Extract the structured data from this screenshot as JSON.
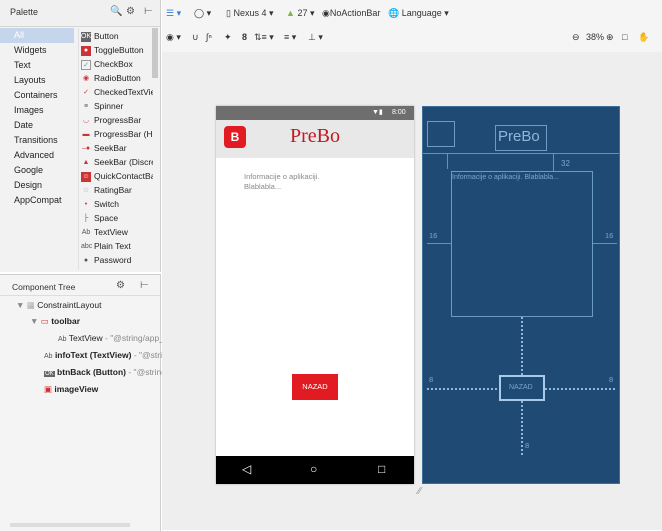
{
  "palette": {
    "title": "Palette",
    "categories": [
      "All",
      "Widgets",
      "Text",
      "Layouts",
      "Containers",
      "Images",
      "Date",
      "Transitions",
      "Advanced",
      "Google",
      "Design",
      "AppCompat"
    ],
    "widgets": [
      {
        "label": "Button",
        "icon": "button-icon"
      },
      {
        "label": "ToggleButton",
        "icon": "togglebutton-icon"
      },
      {
        "label": "CheckBox",
        "icon": "checkbox-icon"
      },
      {
        "label": "RadioButton",
        "icon": "radiobutton-icon"
      },
      {
        "label": "CheckedTextView",
        "icon": "checkedtextview-icon"
      },
      {
        "label": "Spinner",
        "icon": "spinner-icon"
      },
      {
        "label": "ProgressBar",
        "icon": "progressbar-icon"
      },
      {
        "label": "ProgressBar (Ho",
        "icon": "progressbar-horizontal-icon"
      },
      {
        "label": "SeekBar",
        "icon": "seekbar-icon"
      },
      {
        "label": "SeekBar (Discret",
        "icon": "seekbar-discrete-icon"
      },
      {
        "label": "QuickContactBa",
        "icon": "quickcontactbadge-icon"
      },
      {
        "label": "RatingBar",
        "icon": "ratingbar-icon"
      },
      {
        "label": "Switch",
        "icon": "switch-icon"
      },
      {
        "label": "Space",
        "icon": "space-icon"
      },
      {
        "label": "TextView",
        "icon": "textview-icon"
      },
      {
        "label": "Plain Text",
        "icon": "plaintext-icon"
      },
      {
        "label": "Password",
        "icon": "password-icon"
      }
    ]
  },
  "component_tree": {
    "title": "Component Tree",
    "nodes": [
      {
        "label": "ConstraintLayout",
        "detail": ""
      },
      {
        "label": "toolbar",
        "detail": ""
      },
      {
        "label": "TextView",
        "detail": "- \"@string/app_n"
      },
      {
        "label": "infoText (TextView)",
        "detail": "- \"@strin"
      },
      {
        "label": "btnBack (Button)",
        "detail": "- \"@string/"
      },
      {
        "label": "imageView",
        "detail": ""
      }
    ]
  },
  "toolbar": {
    "device": "Nexus 4",
    "api": "27",
    "theme": "NoActionBar",
    "language": "Language",
    "zoom": "38%"
  },
  "phone": {
    "status_time": "8:00",
    "app_title": "PreBo",
    "logo_text": "B",
    "info_line1": "Informacije o aplikaciji.",
    "info_line2": "Blablabla...",
    "button_label": "NAZAD"
  },
  "blueprint": {
    "title": "PreBo",
    "info": "Informacije o aplikaciji. Blablabla...",
    "button_label": "NAZAD",
    "margin_top": "32",
    "margin_left": "16",
    "margin_right": "16",
    "margin_btn_left": "8",
    "margin_btn_right": "8",
    "margin_btn_bottom": "8"
  },
  "colors": {
    "accent": "#e21b22",
    "blueprint_bg": "#1e4a73"
  }
}
